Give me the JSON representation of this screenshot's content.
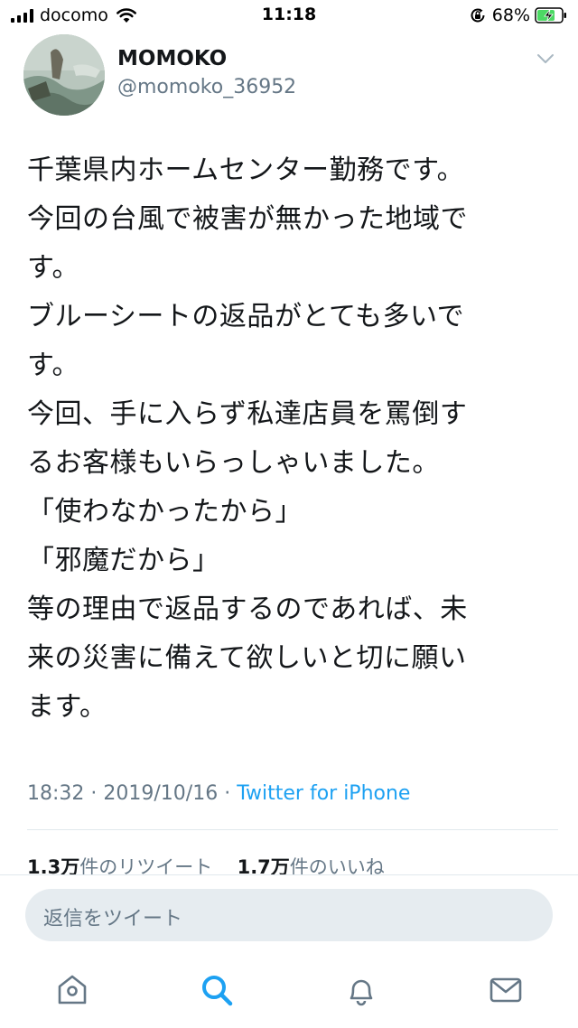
{
  "status_bar": {
    "carrier": "docomo",
    "time": "11:18",
    "battery_percent": "68%"
  },
  "tweet": {
    "display_name": "MOMOKO",
    "handle": "@momoko_36952",
    "text": "千葉県内ホームセンター勤務です。\n今回の台風で被害が無かった地域で\nす。\nブルーシートの返品がとても多いで\nす。\n今回、手に入らず私達店員を罵倒す\nるお客様もいらっしゃいました。\n「使わなかったから」\n「邪魔だから」\n等の理由で返品するのであれば、未\n来の災害に備えて欲しいと切に願い\nます。",
    "time": "18:32",
    "date": "2019/10/16",
    "separator": "·",
    "source": "Twitter for iPhone",
    "retweet_count": "1.3万",
    "retweet_label": "件のリツイート",
    "like_count": "1.7万",
    "like_label": "件のいいね"
  },
  "reply": {
    "placeholder": "返信をツイート"
  },
  "tabs": [
    {
      "name": "home",
      "icon": "home-icon"
    },
    {
      "name": "search",
      "icon": "search-icon"
    },
    {
      "name": "notifications",
      "icon": "bell-icon"
    },
    {
      "name": "messages",
      "icon": "mail-icon"
    }
  ],
  "colors": {
    "accent": "#1da1f2",
    "secondary_text": "#657786",
    "primary_text": "#14171a",
    "battery_charging": "#4cd964"
  }
}
